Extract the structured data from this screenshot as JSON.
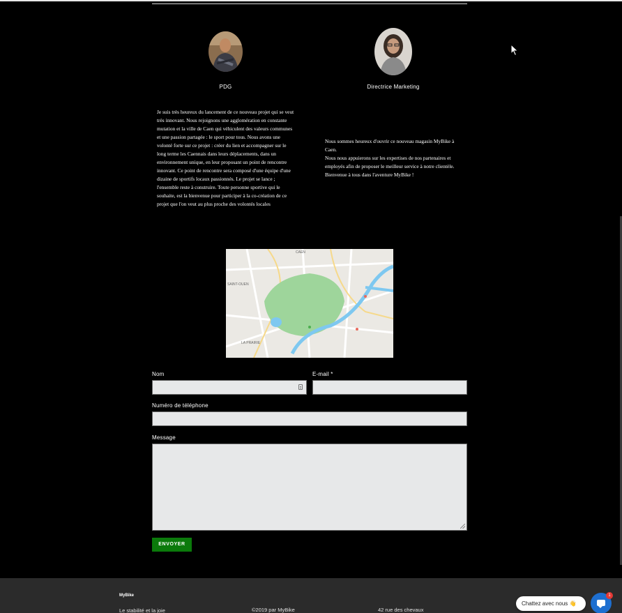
{
  "team": [
    {
      "role": "PDG"
    },
    {
      "role": "Directrice Marketing"
    }
  ],
  "bios": {
    "left": "Je suis très heureux du lancement de ce nouveau projet qui se veut très innovant. Nous rejoignons une agglomération en constante mutation et la ville de Caen qui véhiculent des valeurs communes et une passion partagée : le sport pour tous. Nous avons une volonté forte sur ce projet : créer du lien et accompagner sur le long terme les Caennais dans leurs déplacements, dans un environnement unique, en leur proposant un point de rencontre innovant. Ce point de rencontre sera composé d'une équipe d'une dizaine de sportifs locaux passionnés. Le projet se lance ; l'ensemble reste à construire. Toute personne sportive qui le souhaite, est la bienvenue pour participer à la co-création de ce projet que l'on veut au plus proche des volontés locales",
    "right_lines": [
      " Nous sommes heureux d'ouvrir ce nouveau magasin MyBike à Caen.",
      "Nous nous appuierons sur les expertises de nos partenaires et employés afin de proposer le meilleur service à notre clientèle.",
      "Bienvenue à tous dans l'aventure MyBike !"
    ]
  },
  "map": {
    "labels": {
      "north": "CAEN",
      "west": "SAINT-OUEN",
      "south": "LA PRAIRIE"
    }
  },
  "form": {
    "name_label": "Nom",
    "email_label": "E-mail *",
    "phone_label": "Numéro de téléphone",
    "message_label": "Message",
    "name_value": "",
    "email_value": "",
    "phone_value": "",
    "message_value": "",
    "submit_label": "ENVOYER"
  },
  "footer": {
    "brand": "MyBike",
    "col1": "Le stabilité et la joie ",
    "col2": "©2019 par MyBike",
    "col3": "42 rue des chevaux"
  },
  "chat": {
    "label": "Chattez avec nous 👋",
    "badge": "1"
  },
  "colors": {
    "background": "#000000",
    "submit": "#0b7a0b",
    "footer": "#2b2b2b",
    "chat": "#1e6fd0",
    "map_park": "#9ed59b",
    "map_river": "#7ec8f0"
  }
}
